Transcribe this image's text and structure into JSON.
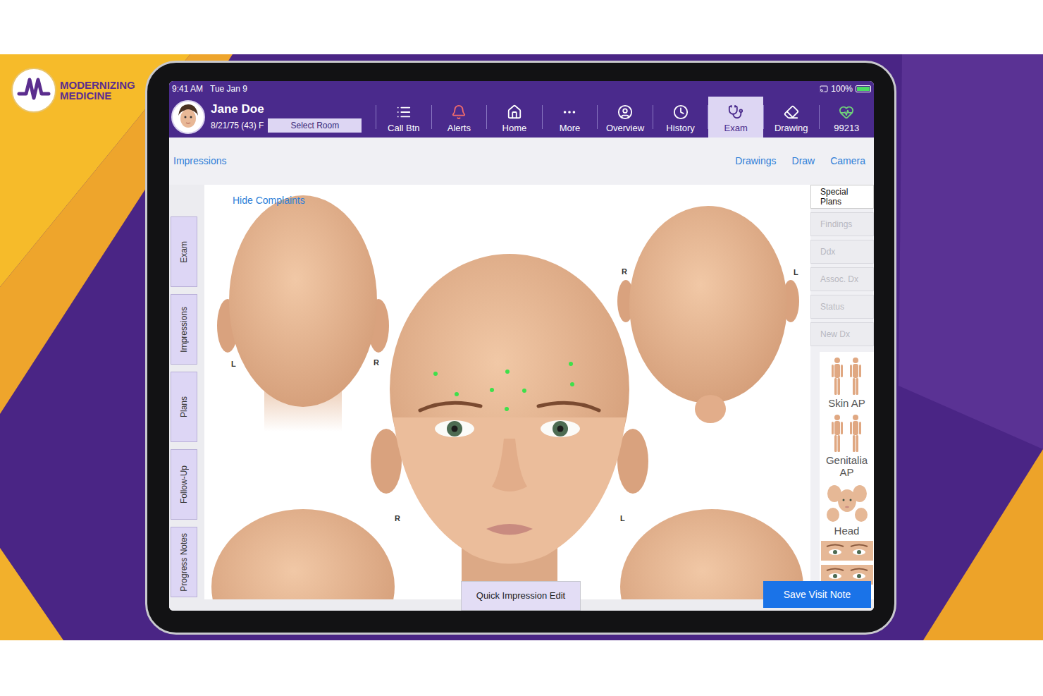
{
  "logo": {
    "line1": "MODERNIZING",
    "line2": "MEDICINE"
  },
  "status_bar": {
    "time": "9:41 AM",
    "date": "Tue Jan 9",
    "battery": "100%",
    "battery_level": 1
  },
  "patient": {
    "name": "Jane Doe",
    "dob": "8/21/75 (43) F",
    "room_button": "Select Room"
  },
  "nav": [
    {
      "label": "Call Btn",
      "selected": false
    },
    {
      "label": "Alerts",
      "selected": false
    },
    {
      "label": "Home",
      "selected": false
    },
    {
      "label": "More",
      "selected": false
    },
    {
      "label": "Overview",
      "selected": false
    },
    {
      "label": "History",
      "selected": false
    },
    {
      "label": "Exam",
      "selected": true
    },
    {
      "label": "Drawing",
      "selected": false
    },
    {
      "label": "99213",
      "selected": false
    }
  ],
  "toolbar": {
    "left": "Impressions",
    "links": [
      "Drawings",
      "Draw",
      "Camera"
    ]
  },
  "side_tabs": [
    {
      "label": "Exam",
      "selected": false
    },
    {
      "label": "Impressions",
      "selected": false
    },
    {
      "label": "Plans",
      "selected": false
    },
    {
      "label": "Follow-Up",
      "selected": false
    },
    {
      "label": "Progress Notes",
      "selected": false
    }
  ],
  "canvas": {
    "hide_link": "Hide Complaints",
    "complaints_visible": true,
    "view_labels": [
      "L",
      "R",
      "R",
      "L",
      "R",
      "L"
    ]
  },
  "actions": [
    {
      "label": "Special Plans",
      "disabled": false
    },
    {
      "label": "Findings",
      "disabled": true
    },
    {
      "label": "Ddx",
      "disabled": true
    },
    {
      "label": "Assoc. Dx",
      "disabled": true
    },
    {
      "label": "Status",
      "disabled": true
    },
    {
      "label": "New Dx",
      "disabled": true
    }
  ],
  "thumbnails": [
    {
      "label": "Skin AP",
      "kind": "body"
    },
    {
      "label": "Genitalia AP",
      "kind": "body"
    },
    {
      "label": "Head",
      "kind": "heads"
    },
    {
      "kind": "eyes"
    },
    {
      "kind": "eyes"
    }
  ],
  "buttons": {
    "quick_edit": "Quick Impression Edit",
    "save": "Save Visit Note"
  }
}
